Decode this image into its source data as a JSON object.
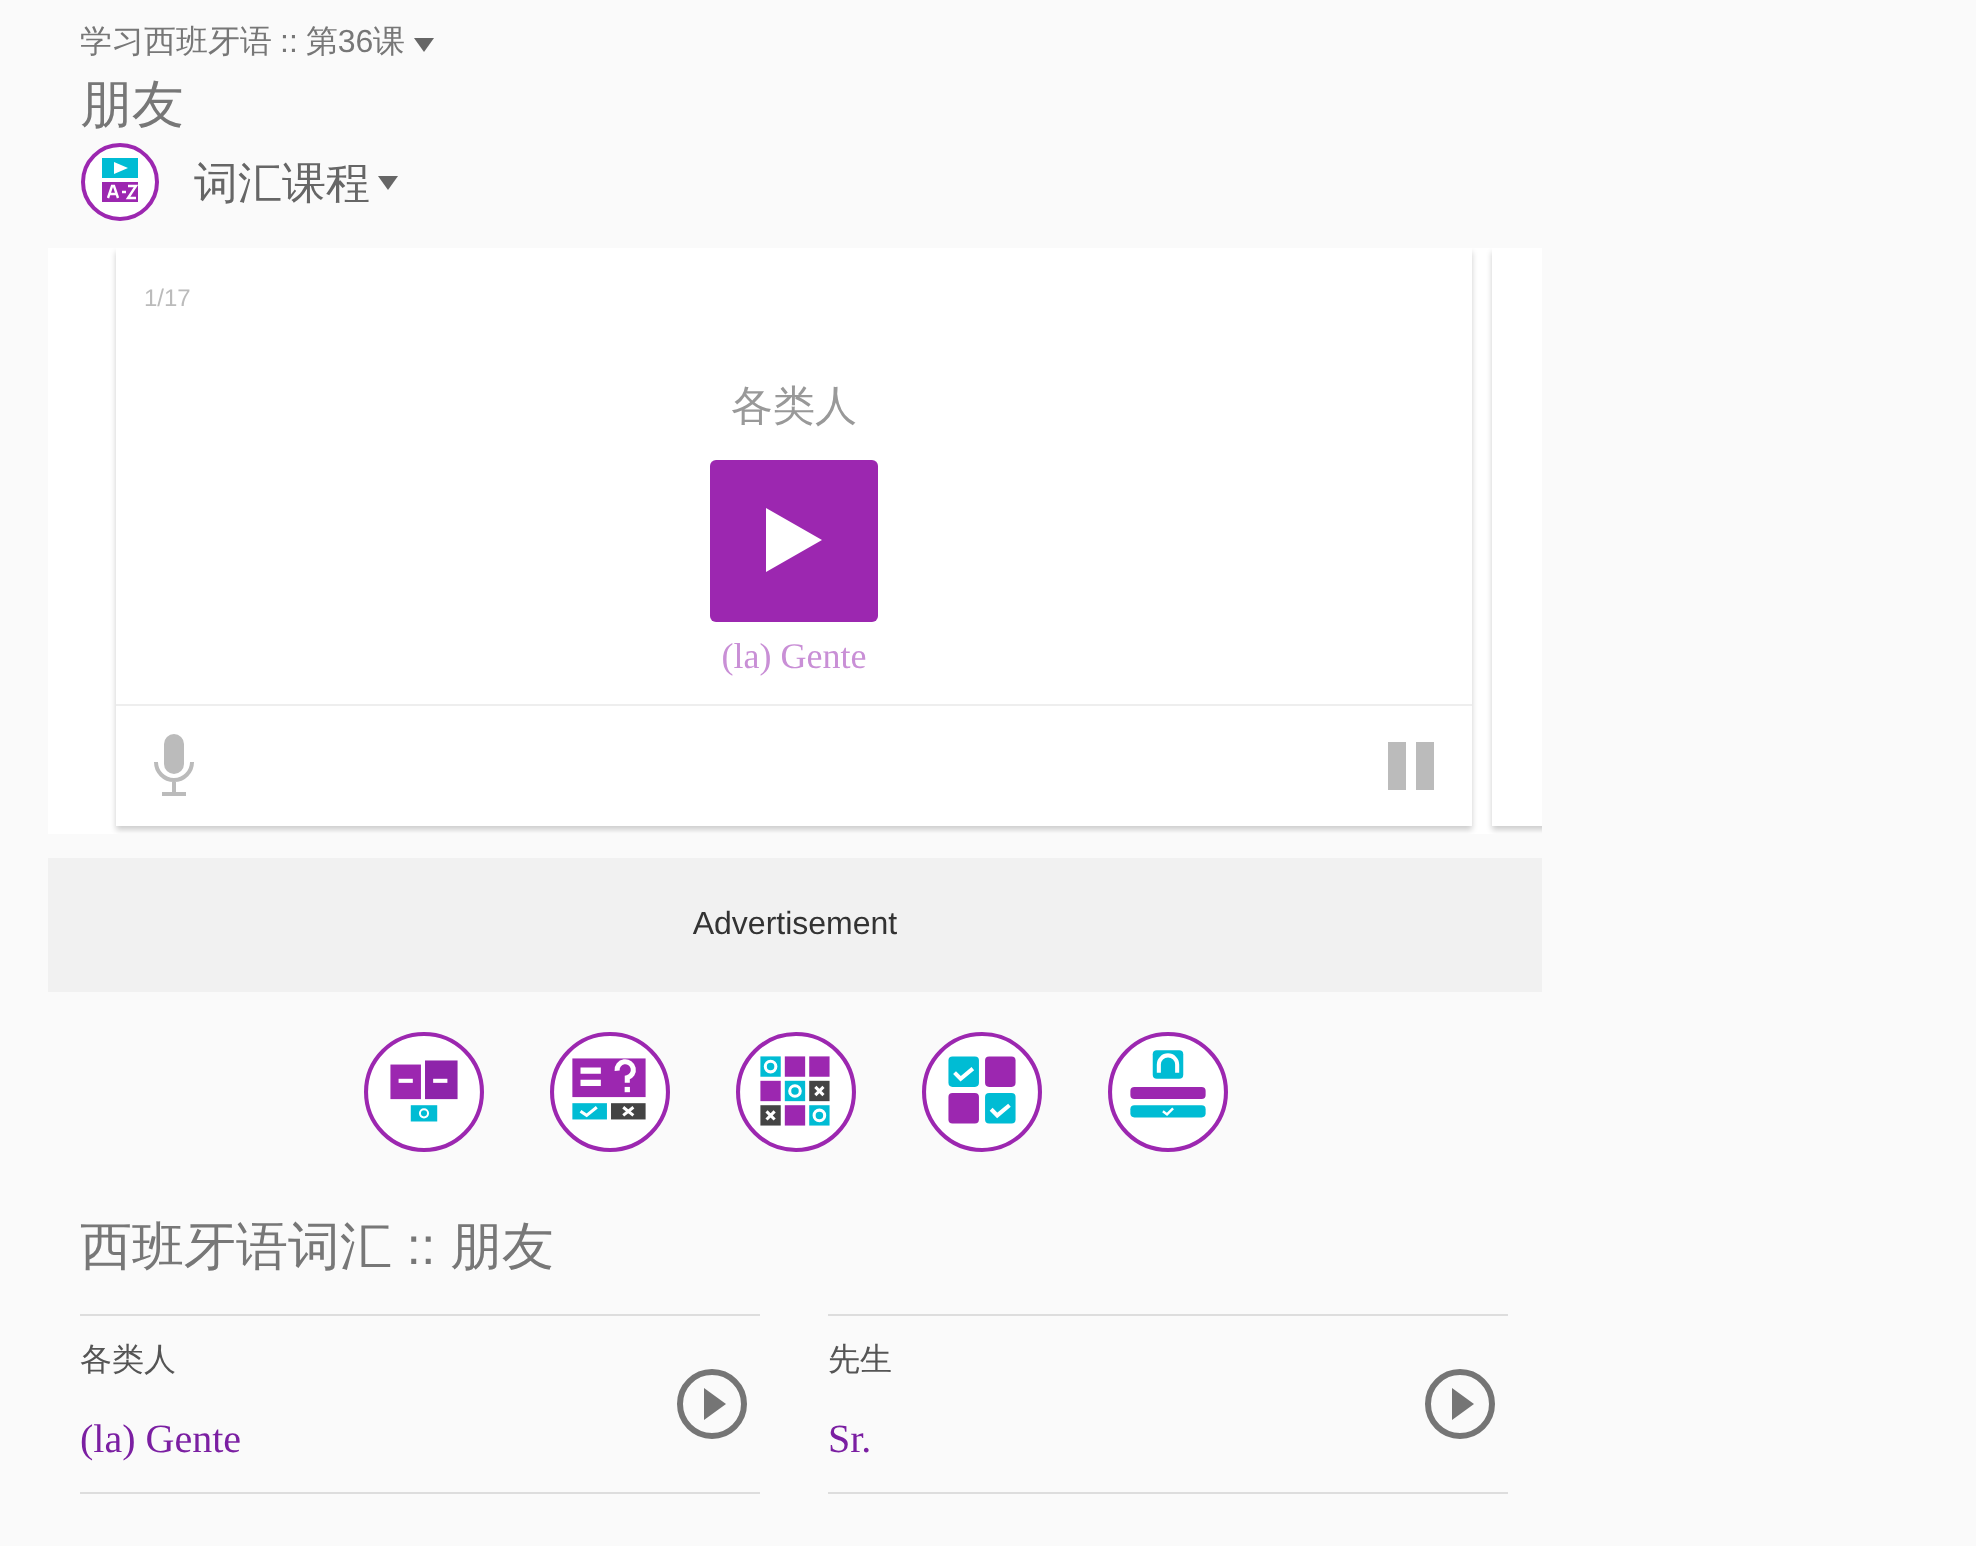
{
  "breadcrumb": {
    "course": "学习西班牙语",
    "separator": "::",
    "lesson": "第36课"
  },
  "title": "朋友",
  "lesson_type": {
    "label": "词汇课程"
  },
  "flashcard": {
    "counter": "1/17",
    "word": "各类人",
    "translation": "(la) Gente"
  },
  "advertisement": "Advertisement",
  "activities": [
    {
      "kind": "memory"
    },
    {
      "kind": "quiz"
    },
    {
      "kind": "tictactoe"
    },
    {
      "kind": "match"
    },
    {
      "kind": "listening"
    }
  ],
  "vocabulary": {
    "title": "西班牙语词汇 :: 朋友",
    "items": [
      {
        "word": "各类人",
        "translation": "(la) Gente"
      },
      {
        "word": "先生",
        "translation": "Sr."
      }
    ]
  }
}
